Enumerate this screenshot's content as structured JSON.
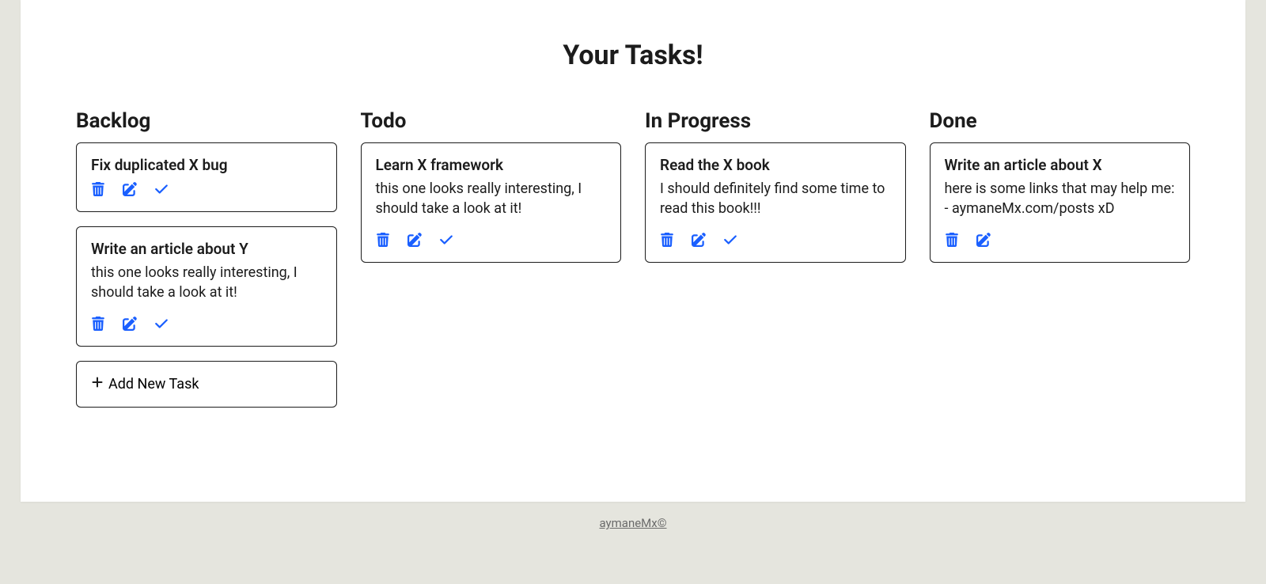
{
  "page_title": "Your Tasks!",
  "columns": [
    {
      "title": "Backlog",
      "cards": [
        {
          "title": "Fix duplicated X bug",
          "description": "",
          "show_check": true
        },
        {
          "title": "Write an article about Y",
          "description": "this one looks really interesting, I should take a look at it!",
          "show_check": true
        }
      ],
      "show_add": true
    },
    {
      "title": "Todo",
      "cards": [
        {
          "title": "Learn X framework",
          "description": "this one looks really interesting, I should take a look at it!",
          "show_check": true
        }
      ],
      "show_add": false
    },
    {
      "title": "In Progress",
      "cards": [
        {
          "title": "Read the X book",
          "description": "I should definitely find some time to read this book!!!",
          "show_check": true
        }
      ],
      "show_add": false
    },
    {
      "title": "Done",
      "cards": [
        {
          "title": "Write an article about X",
          "description": "here is some links that may help me: - aymaneMx.com/posts xD",
          "show_check": false
        }
      ],
      "show_add": false
    }
  ],
  "add_label": "Add New Task",
  "footer": "aymaneMx©",
  "colors": {
    "icon": "#1a5fff"
  }
}
